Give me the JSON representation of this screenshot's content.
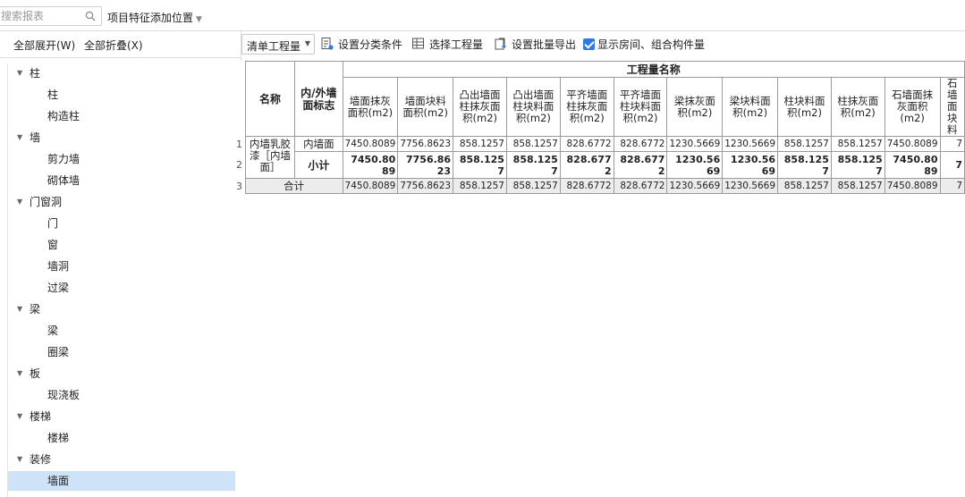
{
  "search": {
    "placeholder": "搜索报表"
  },
  "feature_position": {
    "label": "项目特征添加位置"
  },
  "left_panel": {
    "expand_all": "全部展开(W)",
    "collapse_all": "全部折叠(X)",
    "tree": [
      {
        "label": "柱",
        "children": [
          "柱",
          "构造柱"
        ]
      },
      {
        "label": "墙",
        "children": [
          "剪力墙",
          "砌体墙"
        ]
      },
      {
        "label": "门窗洞",
        "children": [
          "门",
          "窗",
          "墙洞",
          "过梁"
        ]
      },
      {
        "label": "梁",
        "children": [
          "梁",
          "圈梁"
        ]
      },
      {
        "label": "板",
        "children": [
          "现浇板"
        ]
      },
      {
        "label": "楼梯",
        "children": [
          "楼梯"
        ]
      },
      {
        "label": "装修",
        "children": [
          "墙面"
        ]
      }
    ],
    "selected": "墙面"
  },
  "toolbar": {
    "quantity_dropdown": "清单工程量",
    "set_category": "设置分类条件",
    "select_quantity": "选择工程量",
    "batch_export": "设置批量导出",
    "show_rooms": "显示房间、组合构件量",
    "show_rooms_checked": true
  },
  "table": {
    "name_header": "名称",
    "flag_header": "内/外墙面标志",
    "group_header": "工程量名称",
    "columns": [
      "墙面抹灰面积(m2)",
      "墙面块料面积(m2)",
      "凸出墙面柱抹灰面积(m2)",
      "凸出墙面柱块料面积(m2)",
      "平齐墙面柱抹灰面积(m2)",
      "平齐墙面柱块料面积(m2)",
      "梁抹灰面积(m2)",
      "梁块料面积(m2)",
      "柱块料面积(m2)",
      "柱抹灰面积(m2)",
      "石墙面抹灰面积(m2)",
      "石墙面块料"
    ],
    "row_numbers": [
      "1",
      "2",
      "3"
    ],
    "group_name": "内墙乳胶漆［内墙面］",
    "rows": [
      {
        "flag": "内墙面",
        "values": [
          "7450.8089",
          "7756.8623",
          "858.1257",
          "858.1257",
          "828.6772",
          "828.6772",
          "1230.5669",
          "1230.5669",
          "858.1257",
          "858.1257",
          "7450.8089",
          "7"
        ]
      },
      {
        "flag": "小计",
        "values": [
          "7450.8089",
          "7756.8623",
          "858.1257",
          "858.1257",
          "828.6772",
          "828.6772",
          "1230.5669",
          "1230.5669",
          "858.1257",
          "858.1257",
          "7450.8089",
          "7"
        ]
      }
    ],
    "total": {
      "label": "合计",
      "values": [
        "7450.8089",
        "7756.8623",
        "858.1257",
        "858.1257",
        "828.6772",
        "828.6772",
        "1230.5669",
        "1230.5669",
        "858.1257",
        "858.1257",
        "7450.8089",
        "7"
      ]
    }
  },
  "colors": {
    "accent": "#2d7be5",
    "selected_row": "#cfe3f8",
    "total_row": "#ececec"
  }
}
